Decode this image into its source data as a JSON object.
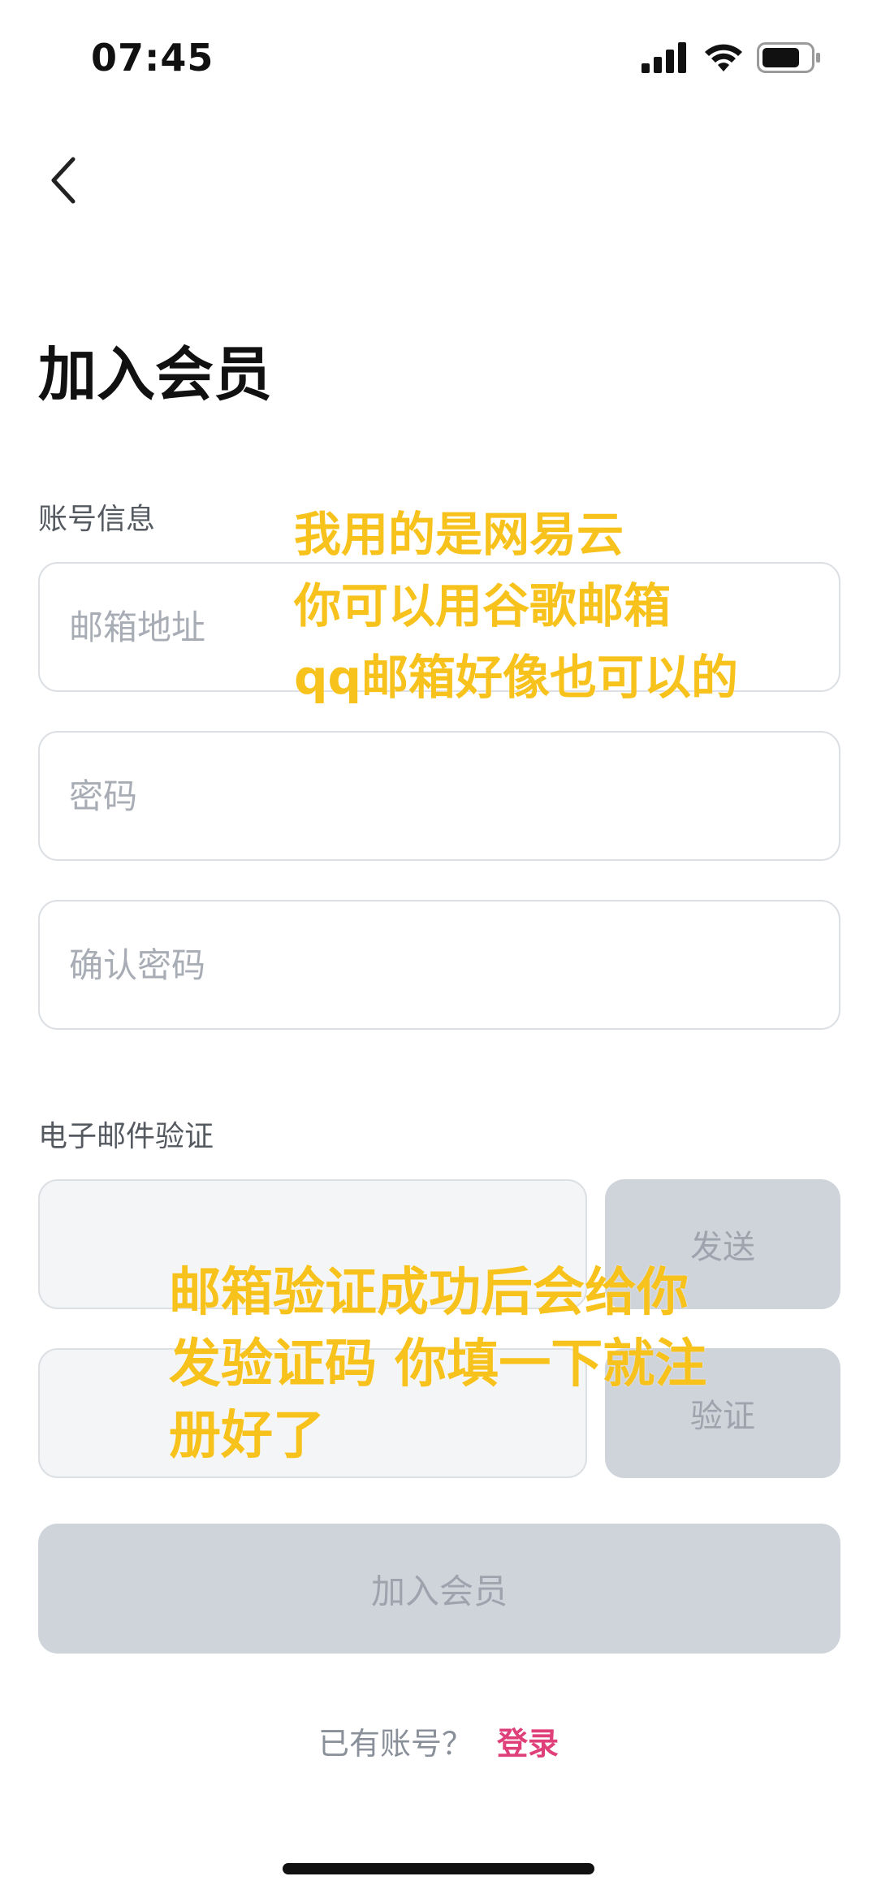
{
  "status_bar": {
    "time": "07:45"
  },
  "header": {
    "title": "加入会员"
  },
  "account_section": {
    "label": "账号信息",
    "email_placeholder": "邮箱地址",
    "password_placeholder": "密码",
    "confirm_password_placeholder": "确认密码"
  },
  "email_verify_section": {
    "label": "电子邮件验证",
    "send_button": "发送",
    "verify_button": "验证"
  },
  "join_button": "加入会员",
  "login_row": {
    "prompt": "已有账号？",
    "link": "登录"
  },
  "annotations": {
    "top_lines": [
      "我用的是网易云",
      "你可以用谷歌邮箱",
      "qq邮箱好像也可以的"
    ],
    "bottom_lines": [
      "邮箱验证成功后会给你",
      "发验证码 你填一下就注",
      "册好了"
    ]
  },
  "colors": {
    "annotation": "#f7c21b",
    "login_link": "#e0407a",
    "disabled_button": "#cfd4db"
  }
}
